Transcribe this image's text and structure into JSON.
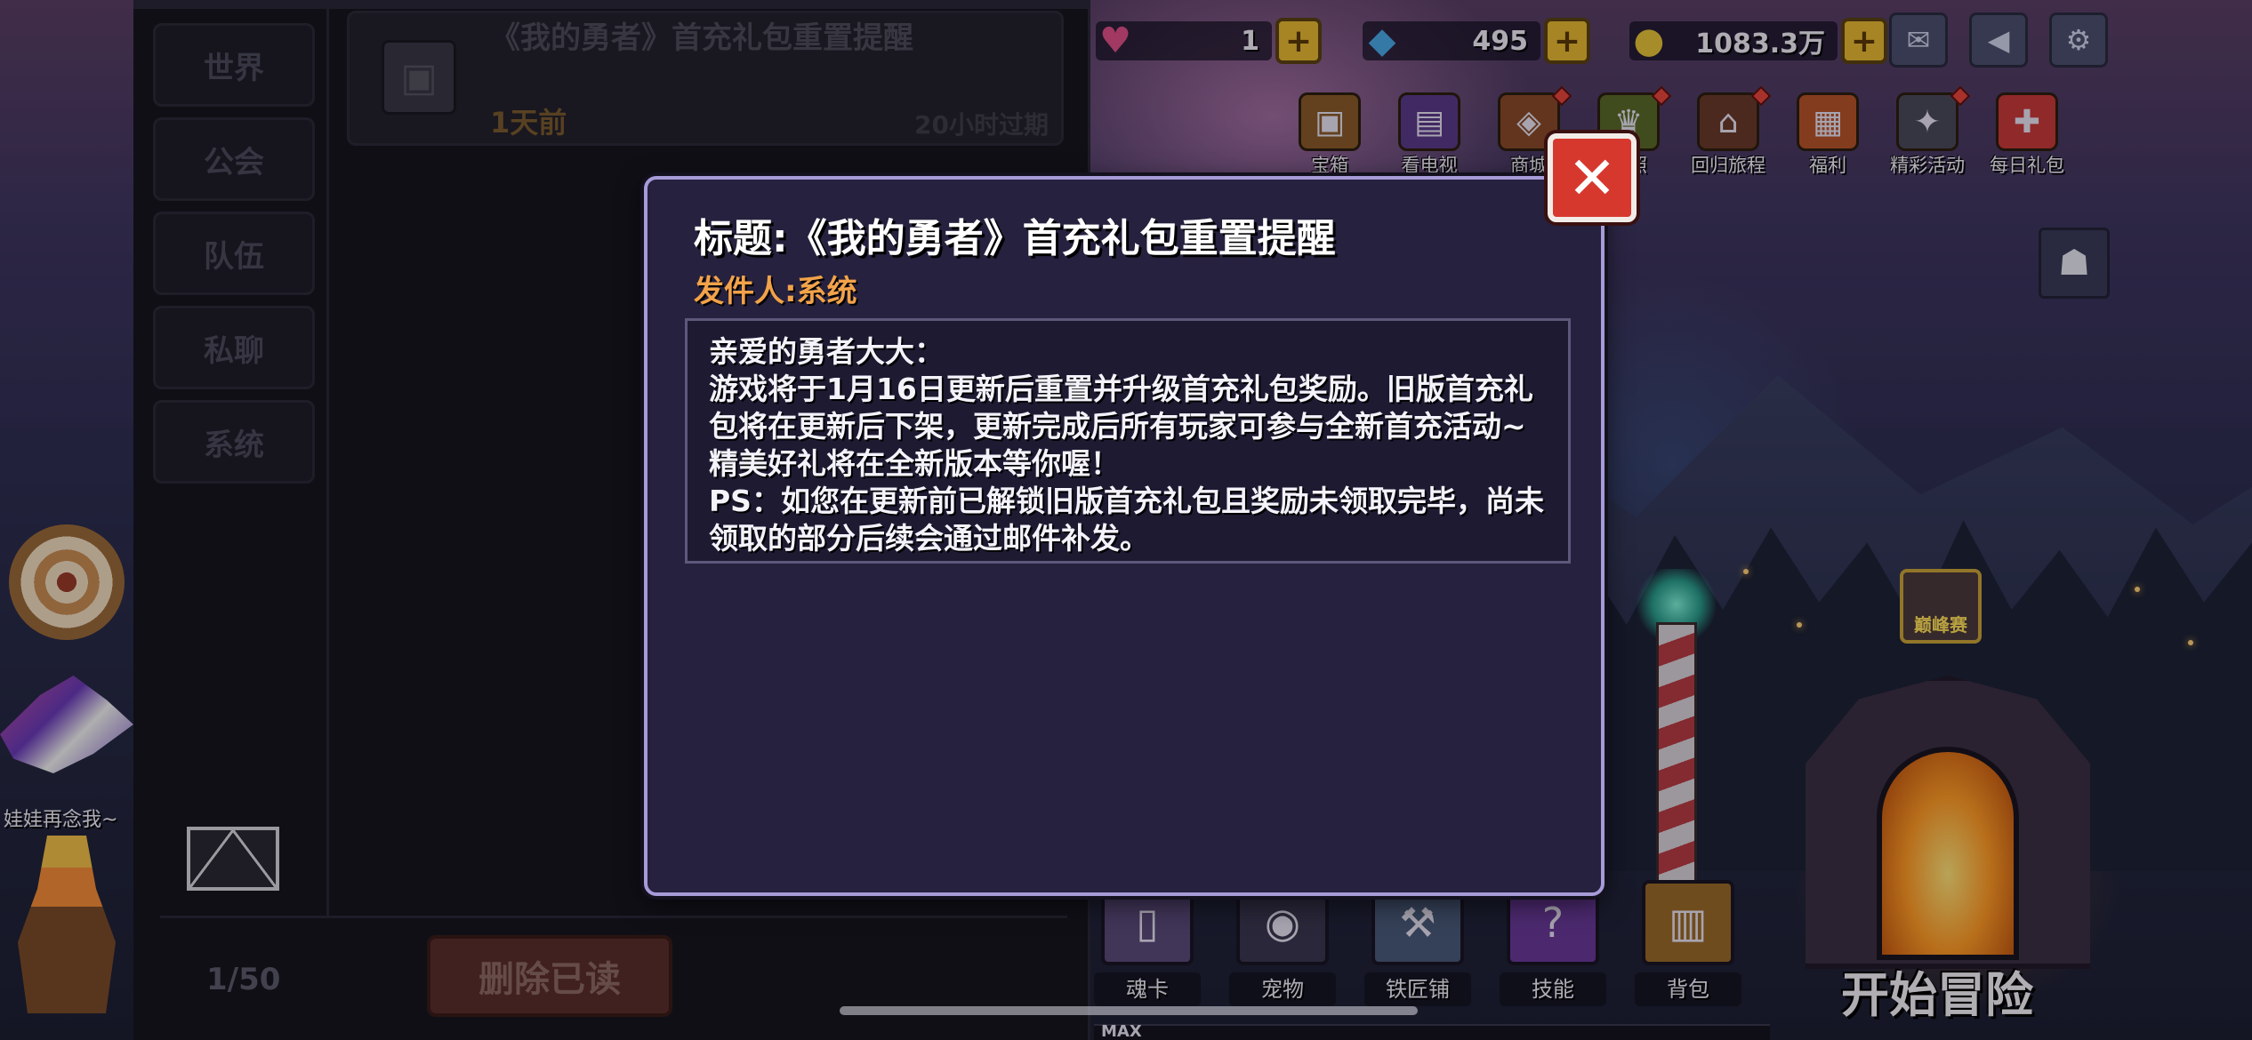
{
  "resources": {
    "hearts": "1",
    "gems": "495",
    "gold": "1083.3万"
  },
  "top_icons": [
    {
      "label": "宝箱",
      "icon": "chest-icon"
    },
    {
      "label": "看电视",
      "icon": "tv-icon"
    },
    {
      "label": "商城",
      "icon": "shop-icon"
    },
    {
      "label": "执照",
      "icon": "license-icon"
    },
    {
      "label": "回归旅程",
      "icon": "return-journey-icon"
    },
    {
      "label": "福利",
      "icon": "welfare-icon"
    },
    {
      "label": "精彩活动",
      "icon": "events-icon"
    },
    {
      "label": "每日礼包",
      "icon": "daily-gift-icon"
    }
  ],
  "peak_badge": "巅峰赛",
  "hero_name": "娃娃再念我~",
  "mail": {
    "tabs": [
      "世界",
      "公会",
      "队伍",
      "私聊",
      "系统"
    ],
    "selected_tab": "系统",
    "item": {
      "subject": "《我的勇者》首充礼包重置提醒",
      "time_ago": "1天前",
      "expires": "20小时过期"
    },
    "page_count": "1/50",
    "delete_read_label": "删除已读"
  },
  "dialog": {
    "title": "标题:《我的勇者》首充礼包重置提醒",
    "sender": "发件人:系统",
    "body": [
      "亲爱的勇者大大：",
      "游戏将于1月16日更新后重置并升级首充礼包奖励。旧版首充礼包将在更新后下架，更新完成后所有玩家可参与全新首充活动~精美好礼将在全新版本等你喔！",
      "PS：如您在更新前已解锁旧版首充礼包且奖励未领取完毕，尚未领取的部分后续会通过邮件补发。"
    ],
    "close_icon": "close-icon"
  },
  "bottom_nav": [
    {
      "label": "魂卡",
      "icon": "soul-card-icon"
    },
    {
      "label": "宠物",
      "icon": "pet-icon"
    },
    {
      "label": "铁匠铺",
      "icon": "blacksmith-icon"
    },
    {
      "label": "技能",
      "icon": "skill-icon"
    },
    {
      "label": "背包",
      "icon": "backpack-icon"
    }
  ],
  "start_adventure": "开始冒险",
  "level_bar_label": "MAX",
  "colors": {
    "dialog_bg": "#26213e",
    "dialog_border": "#a79bd8",
    "sender": "#f2a24a",
    "close_button": "#d6382e"
  }
}
